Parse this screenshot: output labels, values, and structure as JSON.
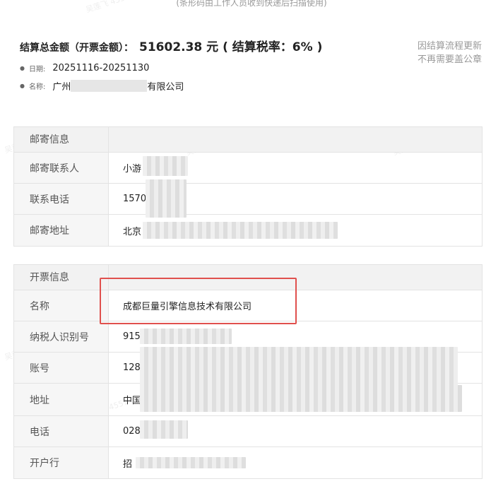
{
  "top_note": "(条形码由工作人员收到快递后扫描使用)",
  "summary": {
    "title_label": "结算总金额（开票金额）：",
    "amount_text": "51602.38 元 ( 结算税率：6% )",
    "date_label": "日期:",
    "date_value": "20251116-20251130",
    "name_label": "名称:",
    "name_prefix": "广州",
    "name_suffix": "有限公司"
  },
  "side_note": {
    "line1": "因结算流程更新",
    "line2": "不再需要盖公章"
  },
  "mail_section": {
    "header": "邮寄信息",
    "rows": [
      {
        "label": "邮寄联系人",
        "value": "小游"
      },
      {
        "label": "联系电话",
        "value": "1570"
      },
      {
        "label": "邮寄地址",
        "value": "北京"
      }
    ]
  },
  "invoice_section": {
    "header": "开票信息",
    "rows": [
      {
        "label": "名称",
        "value": "成都巨量引擎信息技术有限公司"
      },
      {
        "label": "纳税人识别号",
        "value": "915"
      },
      {
        "label": "账号",
        "value": "128"
      },
      {
        "label": "地址",
        "value": "中国"
      },
      {
        "label": "电话",
        "value": "028"
      },
      {
        "label": "开户行",
        "value": "招"
      }
    ]
  },
  "watermark_text": "吴莲飞 4557"
}
